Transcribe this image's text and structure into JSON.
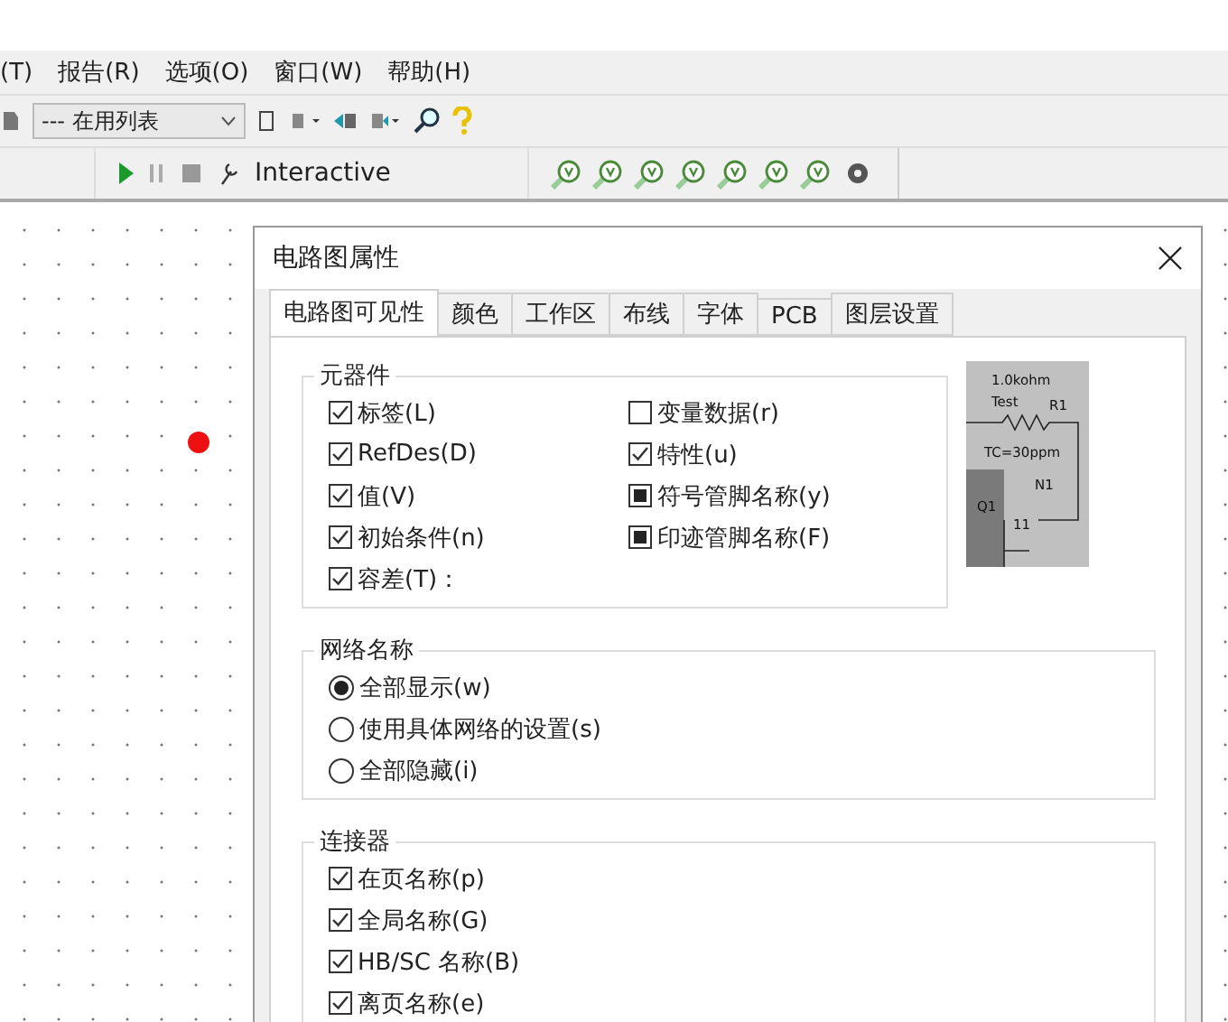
{
  "menu": [
    {
      "label": "(T)"
    },
    {
      "label": "报告(R)"
    },
    {
      "label": "选项(O)"
    },
    {
      "label": "窗口(W)"
    },
    {
      "label": "帮助(H)"
    }
  ],
  "toolbar": {
    "dropdown": "--- 在用列表"
  },
  "sim_toolbar": {
    "mode": "Interactive"
  },
  "canvas": {
    "probe_dot": {
      "color": "#ee1111"
    }
  },
  "dialog": {
    "title": "电路图属性",
    "tabs": [
      {
        "label": "电路图可见性",
        "selected": true
      },
      {
        "label": "颜色",
        "selected": false
      },
      {
        "label": "工作区",
        "selected": false
      },
      {
        "label": "布线",
        "selected": false
      },
      {
        "label": "字体",
        "selected": false
      },
      {
        "label": "PCB",
        "selected": false
      },
      {
        "label": "图层设置",
        "selected": false
      }
    ],
    "components": {
      "title": "元器件",
      "items": [
        {
          "label": "标签(L)",
          "kind": "check",
          "checked": true
        },
        {
          "label": "变量数据(r)",
          "kind": "check",
          "checked": false
        },
        {
          "label": "RefDes(D)",
          "kind": "check",
          "checked": true
        },
        {
          "label": "特性(u)",
          "kind": "check",
          "checked": true
        },
        {
          "label": "值(V)",
          "kind": "check",
          "checked": true
        },
        {
          "label": "符号管脚名称(y)",
          "kind": "tristate",
          "checked": true
        },
        {
          "label": "初始条件(n)",
          "kind": "check",
          "checked": true
        },
        {
          "label": "印迹管脚名称(F)",
          "kind": "tristate",
          "checked": true
        },
        {
          "label": "容差(T)：",
          "kind": "check",
          "checked": true
        }
      ]
    },
    "preview": {
      "labels": [
        "1.0kohm",
        "Test",
        "R1",
        "TC=30ppm",
        "N1",
        "Q1",
        "11"
      ]
    },
    "net_names": {
      "title": "网络名称",
      "options": [
        {
          "label": "全部显示(w)",
          "selected": true
        },
        {
          "label": "使用具体网络的设置(s)",
          "selected": false
        },
        {
          "label": "全部隐藏(i)",
          "selected": false
        }
      ]
    },
    "connectors": {
      "title": "连接器",
      "items": [
        {
          "label": "在页名称(p)",
          "kind": "check",
          "checked": true
        },
        {
          "label": "全局名称(G)",
          "kind": "check",
          "checked": true
        },
        {
          "label": "HB/SC 名称(B)",
          "kind": "check",
          "checked": true
        },
        {
          "label": "离页名称(e)",
          "kind": "check",
          "checked": true
        }
      ]
    }
  }
}
